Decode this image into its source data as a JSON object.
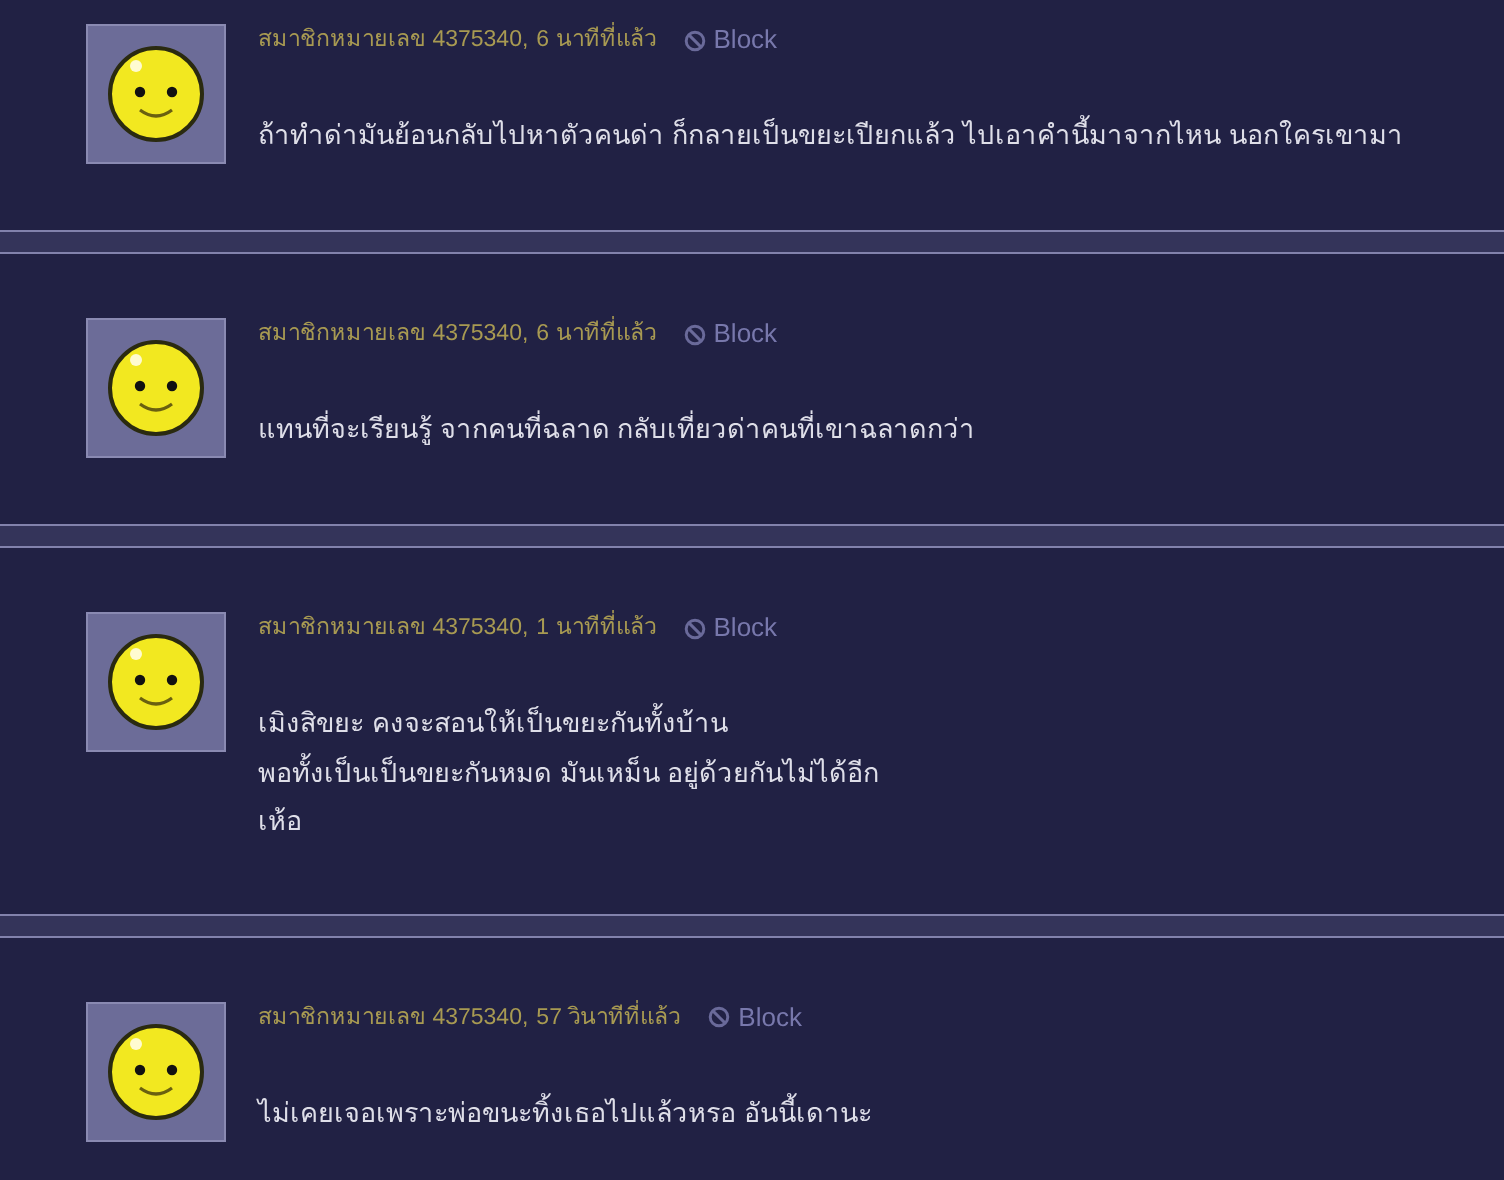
{
  "comments": [
    {
      "author": "สมาชิกหมายเลข 4375340,",
      "time": "6 นาทีที่แล้ว",
      "block": "Block",
      "lines": [
        "ถ้าทำด่ามันย้อนกลับไปหาตัวคนด่า ก็กลายเป็นขยะเปียกแล้ว ไปเอาคำนี้มาจากไหน นอกใครเขามา"
      ]
    },
    {
      "author": "สมาชิกหมายเลข 4375340,",
      "time": "6 นาทีที่แล้ว",
      "block": "Block",
      "lines": [
        "แทนที่จะเรียนรู้ จากคนที่ฉลาด กลับเที่ยวด่าคนที่เขาฉลาดกว่า"
      ]
    },
    {
      "author": "สมาชิกหมายเลข 4375340,",
      "time": "1 นาทีที่แล้ว",
      "block": "Block",
      "lines": [
        "เมิงสิขยะ คงจะสอนให้เป็นขยะกันทั้งบ้าน",
        "พอทั้งเป็นเป็นขยะกันหมด มันเหม็น อยู่ด้วยกันไม่ได้อีก",
        "เห้อ"
      ]
    },
    {
      "author": "สมาชิกหมายเลข 4375340,",
      "time": "57 วินาทีที่แล้ว",
      "block": "Block",
      "lines": [
        "ไม่เคยเจอเพราะพ่อขนะทิ้งเธอไปแล้วหรอ อันนี้เดานะ"
      ]
    }
  ]
}
